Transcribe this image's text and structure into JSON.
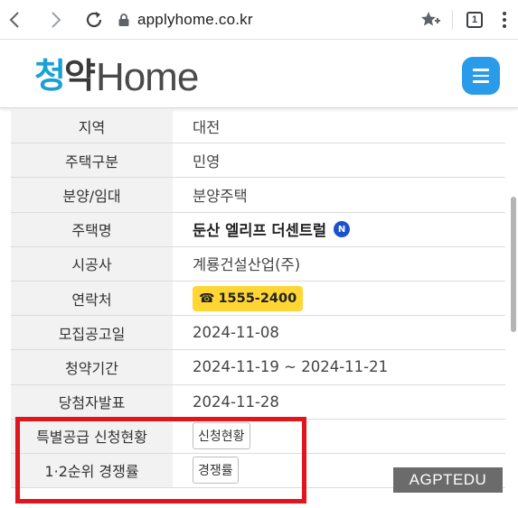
{
  "browser": {
    "url": "applyhome.co.kr",
    "tab_count": "1",
    "icons": [
      "back-arrow-icon",
      "forward-arrow-icon",
      "reload-icon",
      "lock-icon",
      "star-add-icon",
      "tabs-icon",
      "more-vertical-icon"
    ]
  },
  "site": {
    "logo_kr": "청약",
    "logo_en": "Home",
    "colors": {
      "logo_accent": "#1aa0d6",
      "menu_button": "#2a9be8"
    }
  },
  "details": {
    "rows": [
      {
        "label": "지역",
        "value": "대전"
      },
      {
        "label": "주택구분",
        "value": "민영"
      },
      {
        "label": "분양/임대",
        "value": "분양주택"
      },
      {
        "label": "주택명",
        "value": "둔산 엘리프 더센트럴",
        "badge": "N"
      },
      {
        "label": "시공사",
        "value": "계룡건설산업(주)"
      },
      {
        "label": "연락처",
        "value": "1555-2400",
        "icon": "☎"
      },
      {
        "label": "모집공고일",
        "value": "2024-11-08"
      },
      {
        "label": "청약기간",
        "value": "2024-11-19 ~ 2024-11-21"
      },
      {
        "label": "당첨자발표",
        "value": "2024-11-28"
      },
      {
        "label": "특별공급 신청현황",
        "button": "신청현황"
      },
      {
        "label": "1·2순위 경쟁률",
        "button": "경쟁률"
      }
    ]
  },
  "overlay": {
    "watermark": "AGPTEDU",
    "highlight_color": "#e0151d"
  }
}
